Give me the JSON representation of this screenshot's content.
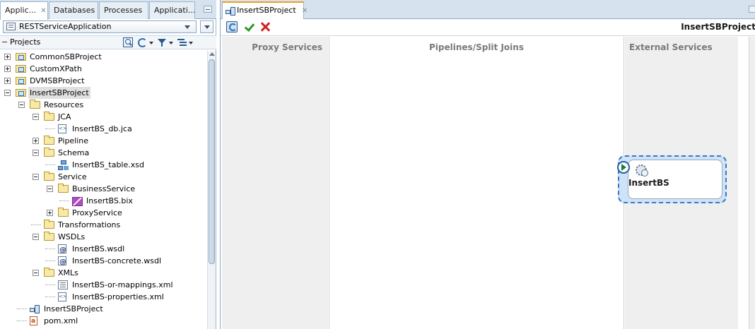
{
  "left_tabs": [
    {
      "label": "Applic...",
      "active": true,
      "closable": true
    },
    {
      "label": "Databases",
      "active": false
    },
    {
      "label": "Processes",
      "active": false
    },
    {
      "label": "Applicati...",
      "active": false
    }
  ],
  "application_selector": {
    "value": "RESTServiceApplication"
  },
  "projects_panel": {
    "title": "Projects"
  },
  "tree": [
    {
      "label": "CommonSBProject",
      "depth": 0,
      "icon": "project-folder-icon",
      "expander": "plus"
    },
    {
      "label": "CustomXPath",
      "depth": 0,
      "icon": "project-folder-icon",
      "expander": "plus"
    },
    {
      "label": "DVMSBProject",
      "depth": 0,
      "icon": "project-folder-icon",
      "expander": "plus"
    },
    {
      "label": "InsertSBProject",
      "depth": 0,
      "icon": "project-folder-icon",
      "expander": "minus",
      "selected": true
    },
    {
      "label": "Resources",
      "depth": 1,
      "icon": "folder-icon",
      "expander": "minus"
    },
    {
      "label": "JCA",
      "depth": 2,
      "icon": "folder-icon",
      "expander": "minus"
    },
    {
      "label": "InsertBS_db.jca",
      "depth": 3,
      "icon": "xml-file-icon",
      "expander": "none"
    },
    {
      "label": "Pipeline",
      "depth": 2,
      "icon": "folder-icon",
      "expander": "plus"
    },
    {
      "label": "Schema",
      "depth": 2,
      "icon": "folder-icon",
      "expander": "minus"
    },
    {
      "label": "InsertBS_table.xsd",
      "depth": 3,
      "icon": "schema-file-icon",
      "expander": "none"
    },
    {
      "label": "Service",
      "depth": 2,
      "icon": "folder-icon",
      "expander": "minus"
    },
    {
      "label": "BusinessService",
      "depth": 3,
      "icon": "folder-icon",
      "expander": "minus"
    },
    {
      "label": "InsertBS.bix",
      "depth": 4,
      "icon": "business-service-file-icon",
      "expander": "none"
    },
    {
      "label": "ProxyService",
      "depth": 3,
      "icon": "folder-icon",
      "expander": "plus"
    },
    {
      "label": "Transformations",
      "depth": 2,
      "icon": "folder-icon",
      "expander": "none"
    },
    {
      "label": "WSDLs",
      "depth": 2,
      "icon": "folder-icon",
      "expander": "minus"
    },
    {
      "label": "InsertBS.wsdl",
      "depth": 3,
      "icon": "wsdl-file-icon",
      "expander": "none"
    },
    {
      "label": "InsertBS-concrete.wsdl",
      "depth": 3,
      "icon": "wsdl-file-icon",
      "expander": "none"
    },
    {
      "label": "XMLs",
      "depth": 2,
      "icon": "folder-icon",
      "expander": "minus"
    },
    {
      "label": "InsertBS-or-mappings.xml",
      "depth": 3,
      "icon": "mapping-file-icon",
      "expander": "none"
    },
    {
      "label": "InsertBS-properties.xml",
      "depth": 3,
      "icon": "xml-file-icon",
      "expander": "none"
    },
    {
      "label": "InsertSBProject",
      "depth": 1,
      "icon": "project-overview-icon",
      "expander": "none"
    },
    {
      "label": "pom.xml",
      "depth": 1,
      "icon": "pom-file-icon",
      "expander": "none"
    }
  ],
  "editor": {
    "tab_label": "InsertSBProject",
    "title": "InsertSBProject",
    "lanes": {
      "proxy": "Proxy Services",
      "pipelines": "Pipelines/Split Joins",
      "external": "External Services"
    },
    "service_node": {
      "name": "InsertBS",
      "icon": "business-service-icon"
    }
  }
}
